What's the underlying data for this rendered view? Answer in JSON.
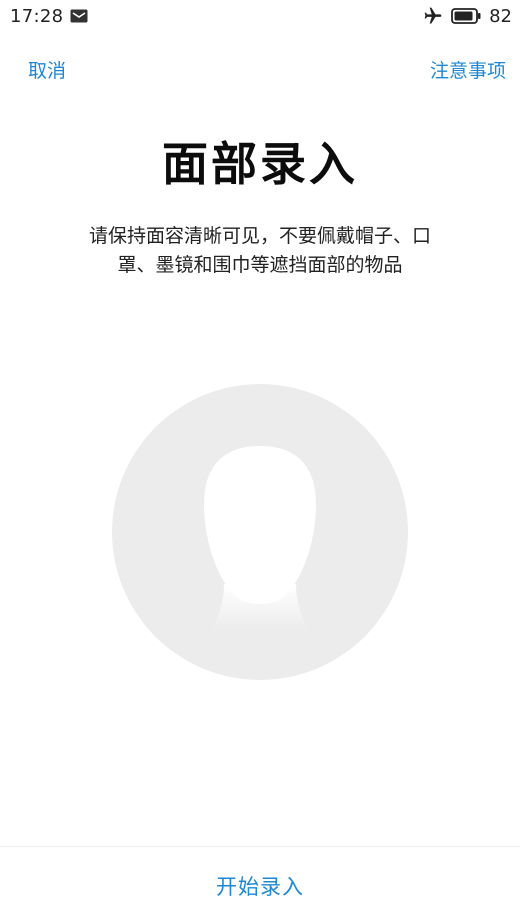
{
  "status_bar": {
    "time": "17:28",
    "battery_level": "82",
    "icons": [
      "message-icon",
      "airplane-icon",
      "battery-icon"
    ]
  },
  "nav": {
    "cancel_label": "取消",
    "notice_label": "注意事项"
  },
  "title": "面部录入",
  "instruction": {
    "line1": "请保持面容清晰可见，不要佩戴帽子、口",
    "line2": "罩、墨镜和围巾等遮挡面部的物品"
  },
  "illustration": {
    "icon": "face-silhouette-icon"
  },
  "bottom": {
    "start_label": "开始录入"
  },
  "colors": {
    "accent": "#1e88d4",
    "circle": "#ececec",
    "face": "#ffffff"
  }
}
